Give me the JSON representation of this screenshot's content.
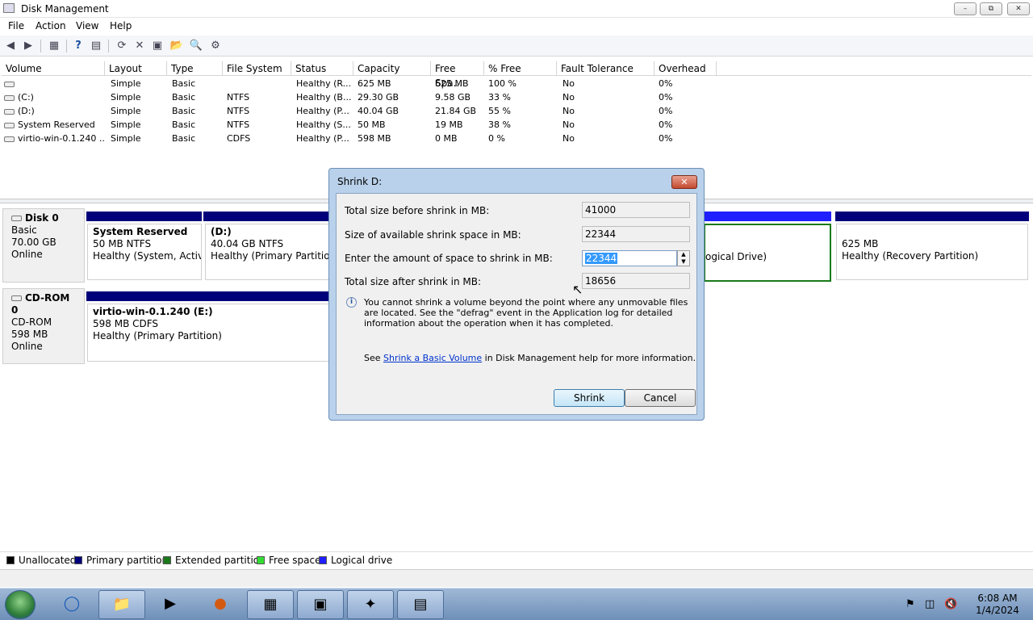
{
  "window": {
    "title": "Disk Management"
  },
  "menu": [
    "File",
    "Action",
    "View",
    "Help"
  ],
  "volume_table": {
    "columns": [
      "Volume",
      "Layout",
      "Type",
      "File System",
      "Status",
      "Capacity",
      "Free Spa...",
      "% Free",
      "Fault Tolerance",
      "Overhead"
    ],
    "rows": [
      [
        "",
        "Simple",
        "Basic",
        "",
        "Healthy (R...",
        "625 MB",
        "625 MB",
        "100 %",
        "No",
        "0%"
      ],
      [
        "(C:)",
        "Simple",
        "Basic",
        "NTFS",
        "Healthy (B...",
        "29.30 GB",
        "9.58 GB",
        "33 %",
        "No",
        "0%"
      ],
      [
        "(D:)",
        "Simple",
        "Basic",
        "NTFS",
        "Healthy (P...",
        "40.04 GB",
        "21.84 GB",
        "55 %",
        "No",
        "0%"
      ],
      [
        "System Reserved",
        "Simple",
        "Basic",
        "NTFS",
        "Healthy (S...",
        "50 MB",
        "19 MB",
        "38 %",
        "No",
        "0%"
      ],
      [
        "virtio-win-0.1.240 ...",
        "Simple",
        "Basic",
        "CDFS",
        "Healthy (P...",
        "598 MB",
        "0 MB",
        "0 %",
        "No",
        "0%"
      ]
    ]
  },
  "disk0": {
    "name": "Disk 0",
    "kind": "Basic",
    "size": "70.00 GB",
    "state": "Online",
    "parts": [
      {
        "name": "System Reserved",
        "size": "50 MB NTFS",
        "status": "Healthy (System, Active,"
      },
      {
        "name": "(D:)",
        "size": "40.04 GB NTFS",
        "status": "Healthy (Primary Partition)"
      },
      {
        "name": "",
        "size": "",
        "status": "ogical Drive)"
      },
      {
        "name": "",
        "size": "625 MB",
        "status": "Healthy (Recovery Partition)"
      }
    ]
  },
  "cdrom0": {
    "name": "CD-ROM 0",
    "kind": "CD-ROM",
    "size": "598 MB",
    "state": "Online",
    "part": {
      "name": "virtio-win-0.1.240  (E:)",
      "size": "598 MB CDFS",
      "status": "Healthy (Primary Partition)"
    }
  },
  "legend": [
    {
      "label": "Unallocated",
      "color": "#000000"
    },
    {
      "label": "Primary partition",
      "color": "#00007a"
    },
    {
      "label": "Extended partition",
      "color": "#1a7a1a"
    },
    {
      "label": "Free space",
      "color": "#33dd33"
    },
    {
      "label": "Logical drive",
      "color": "#1f1fff"
    }
  ],
  "dialog": {
    "title": "Shrink D:",
    "total_before_label": "Total size before shrink in MB:",
    "total_before_value": "41000",
    "available_label": "Size of available shrink space in MB:",
    "available_value": "22344",
    "amount_label": "Enter the amount of space to shrink in MB:",
    "amount_value": "22344",
    "after_label": "Total size after shrink in MB:",
    "after_value": "18656",
    "info_text": "You cannot shrink a volume beyond the point where any unmovable files are located. See the \"defrag\" event in the Application log for detailed information about the operation when it has completed.",
    "see_prefix": "See ",
    "link_text": "Shrink a Basic Volume",
    "see_suffix": " in Disk Management help for more information.",
    "shrink_button": "Shrink",
    "cancel_button": "Cancel"
  },
  "taskbar": {
    "time": "6:08 AM",
    "date": "1/4/2024"
  }
}
